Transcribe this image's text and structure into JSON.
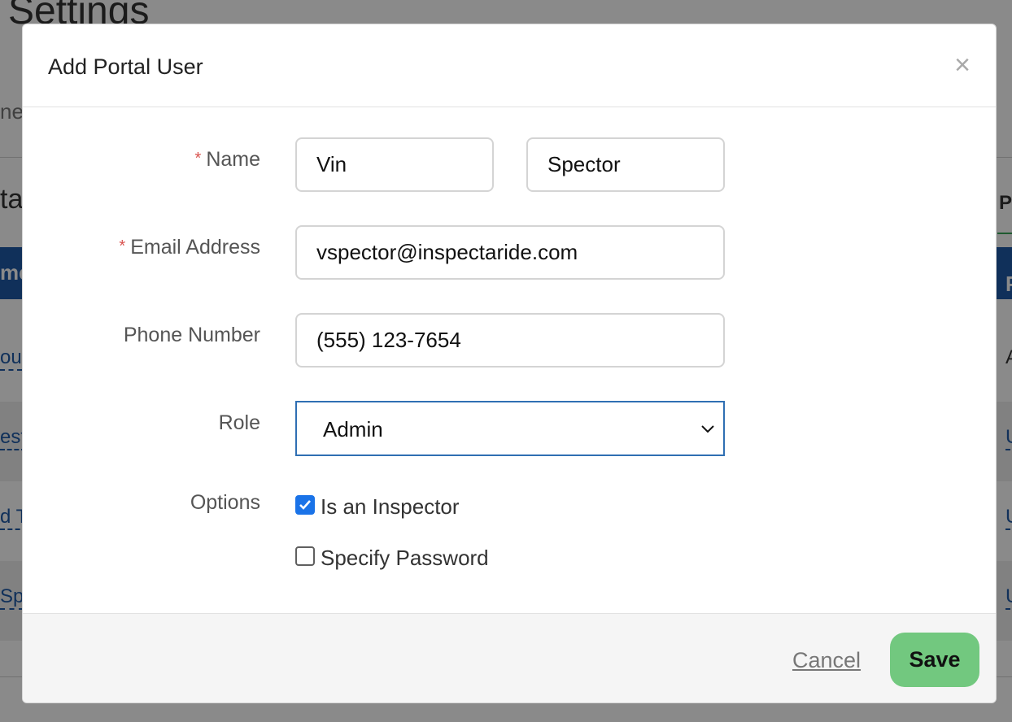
{
  "background": {
    "page_title": "Settings",
    "tab_fragment": "ne",
    "heading_fragment": "ta",
    "right_fragment": "P",
    "table_header_left": "me",
    "table_header_right": "P",
    "rows": [
      {
        "left": "ou",
        "right": "A"
      },
      {
        "left": "est",
        "right": "U"
      },
      {
        "left": "d T",
        "right": "U"
      },
      {
        "left": "Sp",
        "right": "U"
      }
    ]
  },
  "modal": {
    "title": "Add Portal User",
    "close_label": "×",
    "fields": {
      "name_label": "Name",
      "first_name_value": "Vin",
      "last_name_value": "Spector",
      "email_label": "Email Address",
      "email_value": "vspector@inspectaride.com",
      "phone_label": "Phone Number",
      "phone_value": "(555) 123-7654",
      "role_label": "Role",
      "role_value": "Admin",
      "options_label": "Options",
      "required_marker": "*"
    },
    "options": [
      {
        "label": "Is an Inspector",
        "checked": true
      },
      {
        "label": "Specify Password",
        "checked": false
      }
    ],
    "footer": {
      "cancel_label": "Cancel",
      "save_label": "Save"
    }
  },
  "colors": {
    "accent": "#1a73e8",
    "save_green": "#72c87f",
    "required_red": "#d9534f",
    "select_border": "#2f6fb3"
  }
}
